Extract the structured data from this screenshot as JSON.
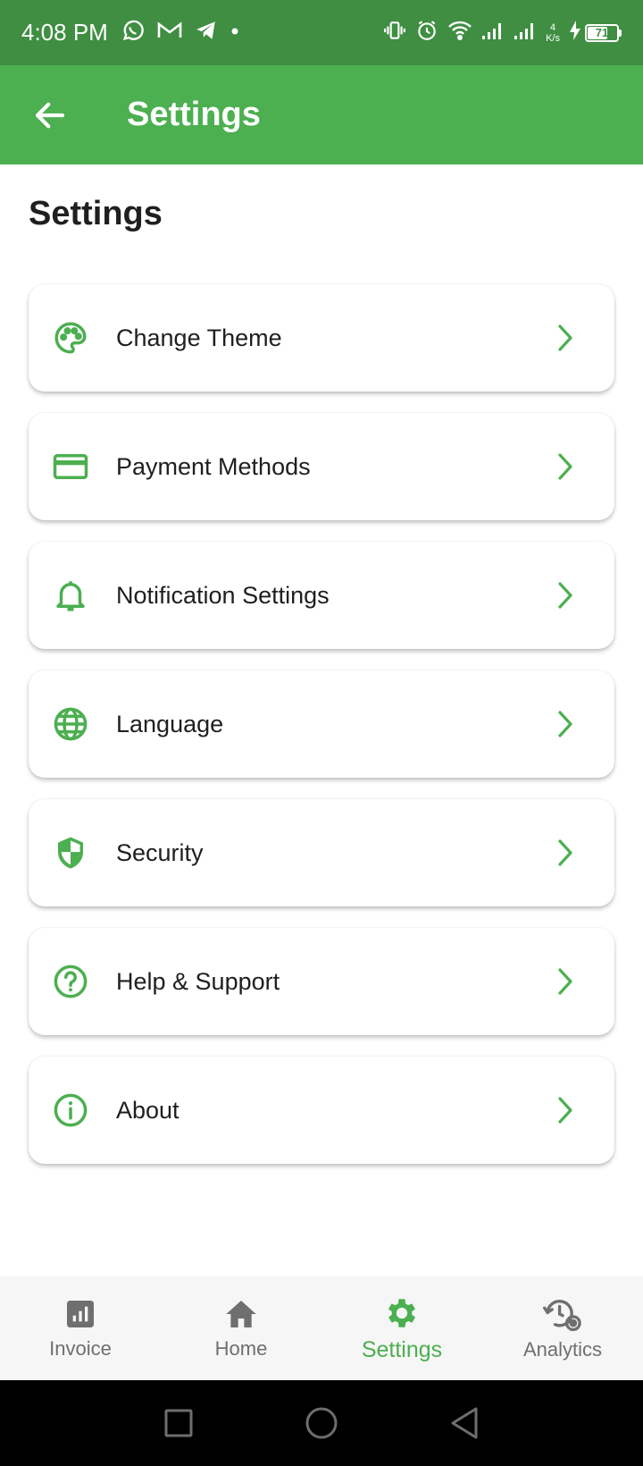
{
  "status_bar": {
    "time": "4:08 PM",
    "net_speed_value": "4",
    "net_speed_unit": "K/s",
    "battery_level": "71",
    "battery_fraction": 0.71
  },
  "app_bar": {
    "title": "Settings"
  },
  "page": {
    "heading": "Settings"
  },
  "settings": {
    "items": [
      {
        "label": "Change Theme",
        "icon": "palette-icon"
      },
      {
        "label": "Payment Methods",
        "icon": "credit-card-icon"
      },
      {
        "label": "Notification Settings",
        "icon": "bell-icon"
      },
      {
        "label": "Language",
        "icon": "globe-icon"
      },
      {
        "label": "Security",
        "icon": "shield-icon"
      },
      {
        "label": "Help & Support",
        "icon": "help-circle-icon"
      },
      {
        "label": "About",
        "icon": "info-icon"
      }
    ]
  },
  "bottom_nav": {
    "items": [
      {
        "label": "Invoice",
        "icon": "invoice-chart-icon"
      },
      {
        "label": "Home",
        "icon": "home-icon"
      },
      {
        "label": "Settings",
        "icon": "gear-icon",
        "active": true
      },
      {
        "label": "Analytics",
        "icon": "history-settings-icon"
      }
    ]
  },
  "colors": {
    "status_bar": "#3f8e42",
    "app_bar": "#4caf50",
    "accent": "#4caf50",
    "nav_inactive": "#6f6f6f",
    "nav_background": "#f6f6f6"
  }
}
